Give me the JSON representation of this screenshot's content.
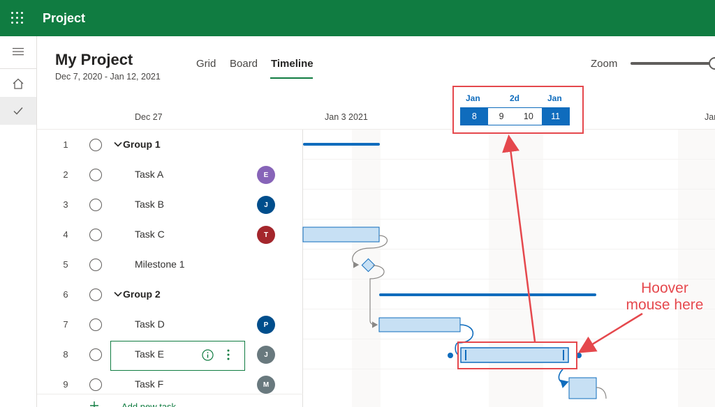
{
  "app": {
    "title": "Project"
  },
  "rail": {
    "items": [
      "menu-icon",
      "home-icon",
      "check-icon"
    ]
  },
  "project": {
    "title": "My Project",
    "dates": "Dec 7, 2020 - Jan 12, 2021"
  },
  "tabs": [
    {
      "label": "Grid"
    },
    {
      "label": "Board"
    },
    {
      "label": "Timeline",
      "active": true
    }
  ],
  "zoom": {
    "label": "Zoom",
    "level": 1.0
  },
  "date_headers": [
    "Dec 27",
    "Jan 3 2021",
    "Jan"
  ],
  "rows": [
    {
      "num": "1",
      "name": "Group 1",
      "group": true
    },
    {
      "num": "2",
      "name": "Task A",
      "avatar": "E",
      "color": "#8764b8"
    },
    {
      "num": "3",
      "name": "Task B",
      "avatar": "J",
      "color": "#004e8c"
    },
    {
      "num": "4",
      "name": "Task C",
      "avatar": "T",
      "color": "#a4262c"
    },
    {
      "num": "5",
      "name": "Milestone 1"
    },
    {
      "num": "6",
      "name": "Group 2",
      "group": true
    },
    {
      "num": "7",
      "name": "Task D",
      "avatar": "P",
      "color": "#004e8c"
    },
    {
      "num": "8",
      "name": "Task E",
      "avatar": "J",
      "color": "#69797e",
      "selected": true
    },
    {
      "num": "9",
      "name": "Task F",
      "avatar": "M",
      "color": "#69797e"
    }
  ],
  "add_task": {
    "label": "Add new task"
  },
  "popup": {
    "month_start": "Jan",
    "duration": "2d",
    "month_end": "Jan",
    "days": [
      "8",
      "9",
      "10",
      "11"
    ]
  },
  "annotation": {
    "line1": "Hoover",
    "line2": "mouse here"
  },
  "colors": {
    "brand": "#107c41",
    "accent": "#0f6cbd",
    "annotation": "#e5484d"
  }
}
